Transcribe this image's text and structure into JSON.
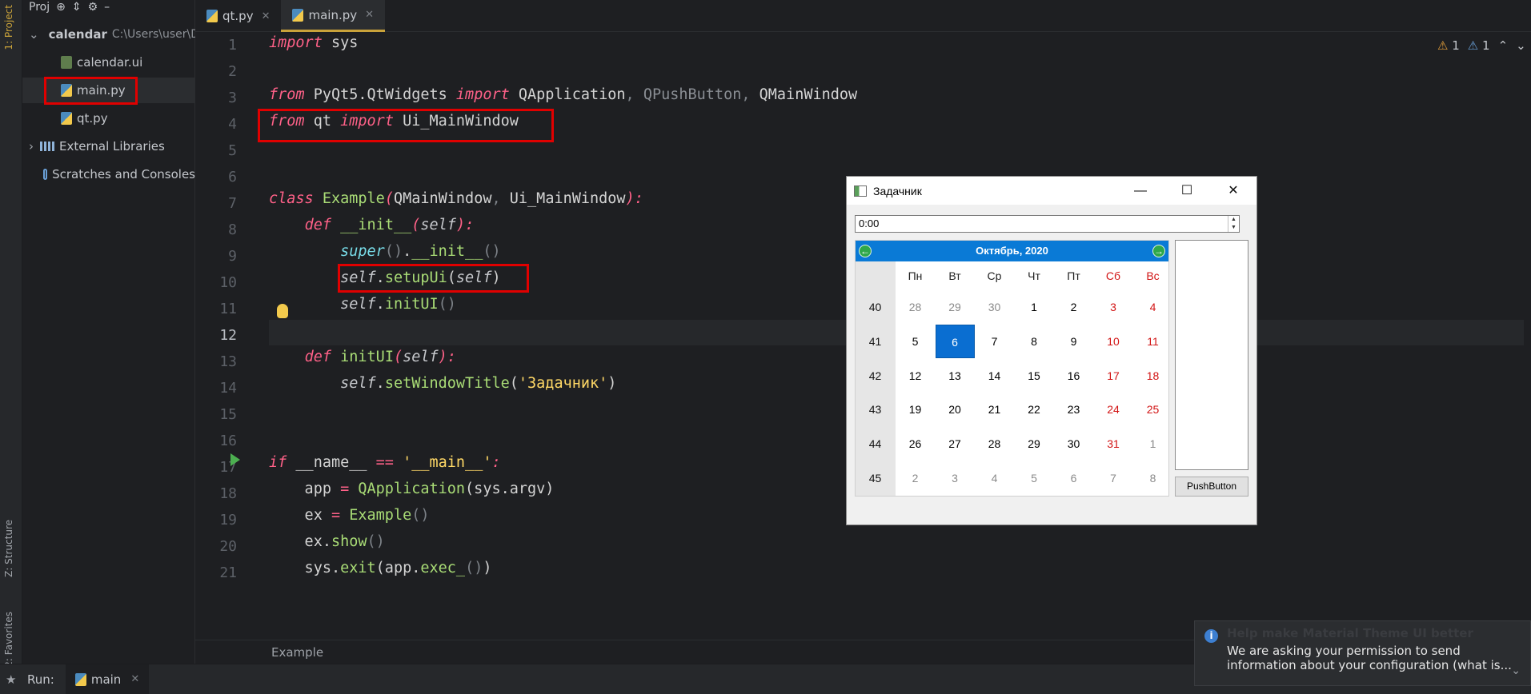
{
  "sidebar": {
    "project_tab": "1: Project",
    "structure_tab": "Z: Structure",
    "favorites_tab": "2: Favorites"
  },
  "project": {
    "toolbar_label": "Proj",
    "tree": [
      {
        "label": "calendar",
        "detail": "C:\\Users\\user\\D"
      },
      {
        "label": "calendar.ui"
      },
      {
        "label": "main.py"
      },
      {
        "label": "qt.py"
      },
      {
        "label": "External Libraries"
      },
      {
        "label": "Scratches and Consoles"
      }
    ]
  },
  "tabs": [
    {
      "label": "qt.py"
    },
    {
      "label": "main.py"
    }
  ],
  "editor": {
    "line_numbers": [
      "1",
      "2",
      "3",
      "4",
      "5",
      "6",
      "7",
      "8",
      "9",
      "10",
      "11",
      "12",
      "13",
      "14",
      "15",
      "16",
      "17",
      "18",
      "19",
      "20",
      "21"
    ],
    "current_line": "12",
    "breadcrumb": "Example"
  },
  "inspections": {
    "warnings": "1",
    "weak_warnings": "1"
  },
  "run": {
    "label": "Run:",
    "tab": "main"
  },
  "notification": {
    "title": "Help make Material Theme UI better",
    "body": "We are asking your permission to send information about your configuration (what is..."
  },
  "qt_window": {
    "title": "Задачник",
    "time_value": "0:00",
    "calendar": {
      "month_year": "Октябрь, 2020",
      "weekdays": [
        "Пн",
        "Вт",
        "Ср",
        "Чт",
        "Пт",
        "Сб",
        "Вс"
      ],
      "weeks": [
        {
          "num": "40",
          "days": [
            "28",
            "29",
            "30",
            "1",
            "2",
            "3",
            "4"
          ]
        },
        {
          "num": "41",
          "days": [
            "5",
            "6",
            "7",
            "8",
            "9",
            "10",
            "11"
          ]
        },
        {
          "num": "42",
          "days": [
            "12",
            "13",
            "14",
            "15",
            "16",
            "17",
            "18"
          ]
        },
        {
          "num": "43",
          "days": [
            "19",
            "20",
            "21",
            "22",
            "23",
            "24",
            "25"
          ]
        },
        {
          "num": "44",
          "days": [
            "26",
            "27",
            "28",
            "29",
            "30",
            "31",
            "1"
          ]
        },
        {
          "num": "45",
          "days": [
            "2",
            "3",
            "4",
            "5",
            "6",
            "7",
            "8"
          ]
        }
      ],
      "selected_day": "6"
    },
    "button_label": "PushButton"
  },
  "colors": {
    "keyword": "#ff6188",
    "function": "#a9dc76",
    "string": "#ffd866",
    "calendar_header": "#0a7ad6",
    "weekend": "#d21414",
    "highlight_box": "#e00000"
  }
}
